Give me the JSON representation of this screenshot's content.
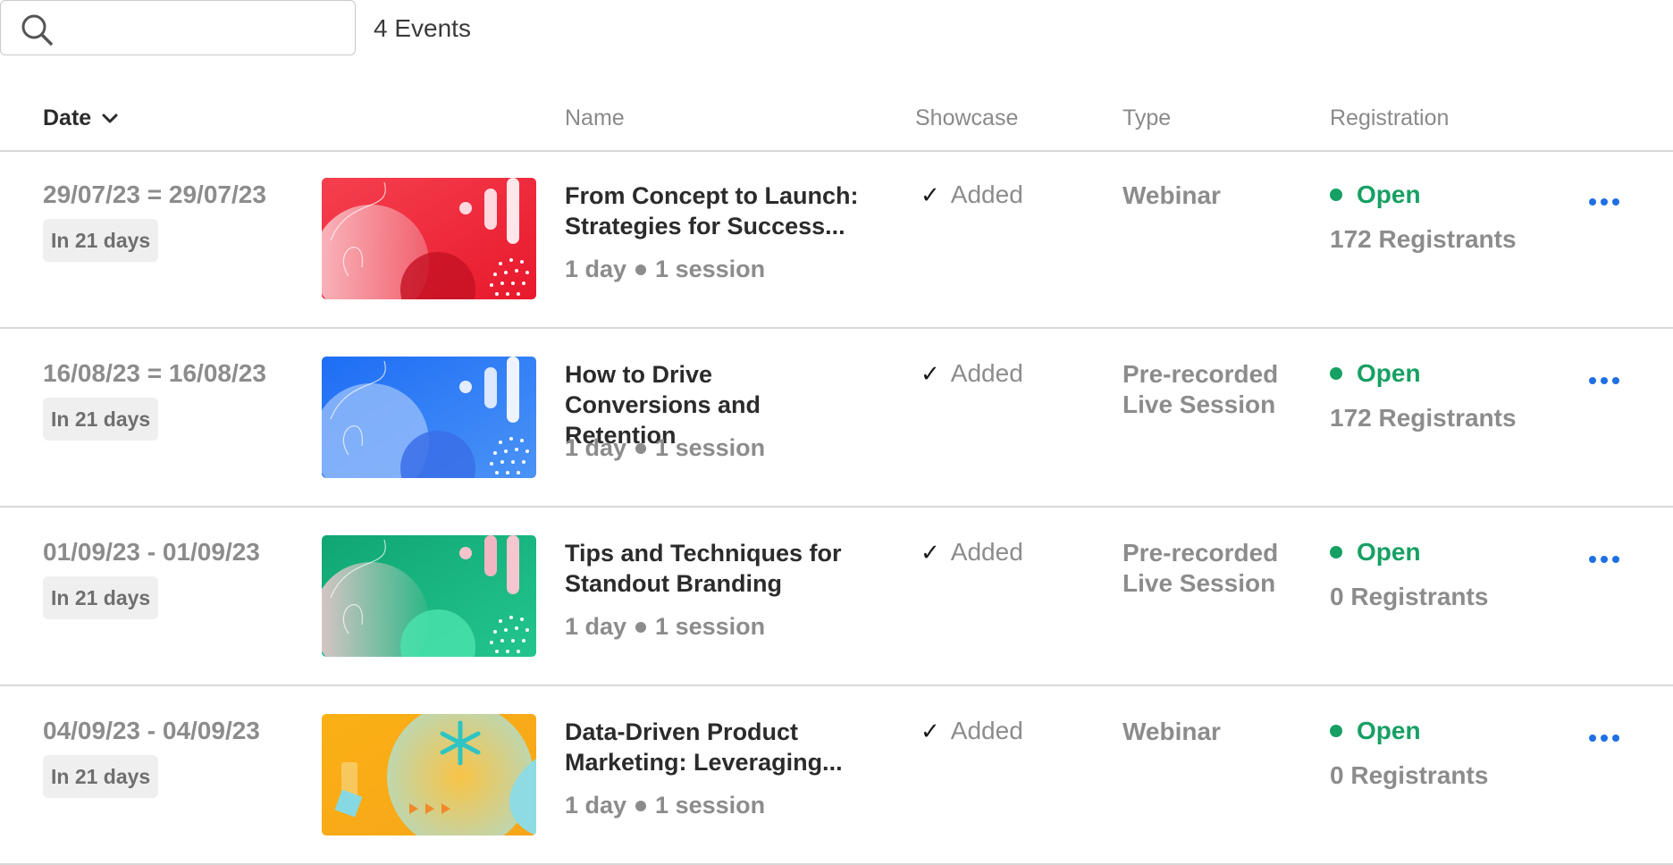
{
  "search": {
    "placeholder": "",
    "value": "",
    "icon": "search-icon"
  },
  "events_count": "4 Events",
  "columns": {
    "date": "Date",
    "name": "Name",
    "showcase": "Showcase",
    "type": "Type",
    "registration": "Registration"
  },
  "colors": {
    "accent": "#1f6fe5",
    "open": "#17a063",
    "thumb_red": "#f2394b",
    "thumb_blue": "#2d7cf2",
    "thumb_green": "#15a577",
    "thumb_orange": "#f8b01e"
  },
  "events": [
    {
      "date": "29/07/23 = 29/07/23",
      "relative": "In 21 days",
      "title": "From Concept to Launch: Strategies for Success...",
      "duration": "1 day",
      "sessions": "1 session",
      "showcase": "Added",
      "type": "Webinar",
      "status": "Open",
      "registrants": "172 Registrants",
      "thumb_theme": "red"
    },
    {
      "date": "16/08/23 = 16/08/23",
      "relative": "In 21 days",
      "title": "How to Drive Conversions and Retention",
      "duration": "1 day",
      "sessions": "1 session",
      "showcase": "Added",
      "type": "Pre-recorded Live Session",
      "status": "Open",
      "registrants": "172 Registrants",
      "thumb_theme": "blue"
    },
    {
      "date": "01/09/23 - 01/09/23",
      "relative": "In 21 days",
      "title": "Tips and Techniques for Standout Branding",
      "duration": "1 day",
      "sessions": "1 session",
      "showcase": "Added",
      "type": "Pre-recorded Live Session",
      "status": "Open",
      "registrants": "0 Registrants",
      "thumb_theme": "green"
    },
    {
      "date": "04/09/23 - 04/09/23",
      "relative": "In 21 days",
      "title": "Data-Driven Product Marketing: Leveraging...",
      "duration": "1 day",
      "sessions": "1 session",
      "showcase": "Added",
      "type": "Webinar",
      "status": "Open",
      "registrants": "0 Registrants",
      "thumb_theme": "orange"
    }
  ]
}
